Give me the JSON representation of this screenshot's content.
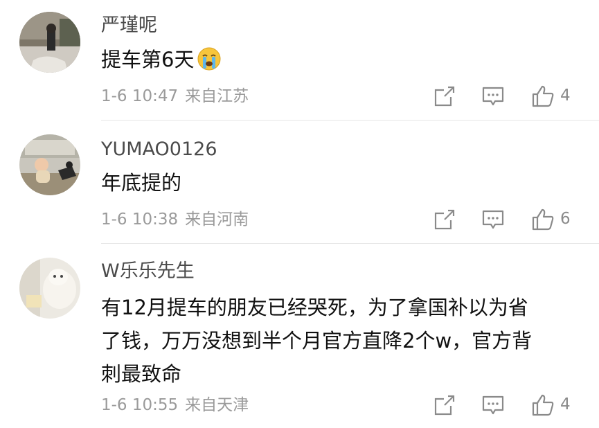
{
  "comments": [
    {
      "username": "严瑾呢",
      "text": "提车第6天",
      "emoji": "crying-face",
      "time": "1-6 10:47",
      "location": "来自江苏",
      "likes": "4"
    },
    {
      "username": "YUMAO0126",
      "text": "年底提的",
      "time": "1-6 10:38",
      "location": "来自河南",
      "likes": "6"
    },
    {
      "username": "W乐乐先生",
      "text_lines": [
        "有12月提车的朋友已经哭死，为了拿国补以为省",
        "了钱，万万没想到半个月官方直降2个w，官方背",
        "刺最致命"
      ],
      "time": "1-6 10:55",
      "location": "来自天津",
      "likes": "4"
    }
  ],
  "icons": {
    "share": "share-icon",
    "reply": "comment-icon",
    "like": "thumbs-up-icon"
  },
  "colors": {
    "username": "#4a4a4a",
    "meta": "#9a9a9a",
    "divider": "#e6e6e6",
    "icon": "#8a8a8a"
  }
}
